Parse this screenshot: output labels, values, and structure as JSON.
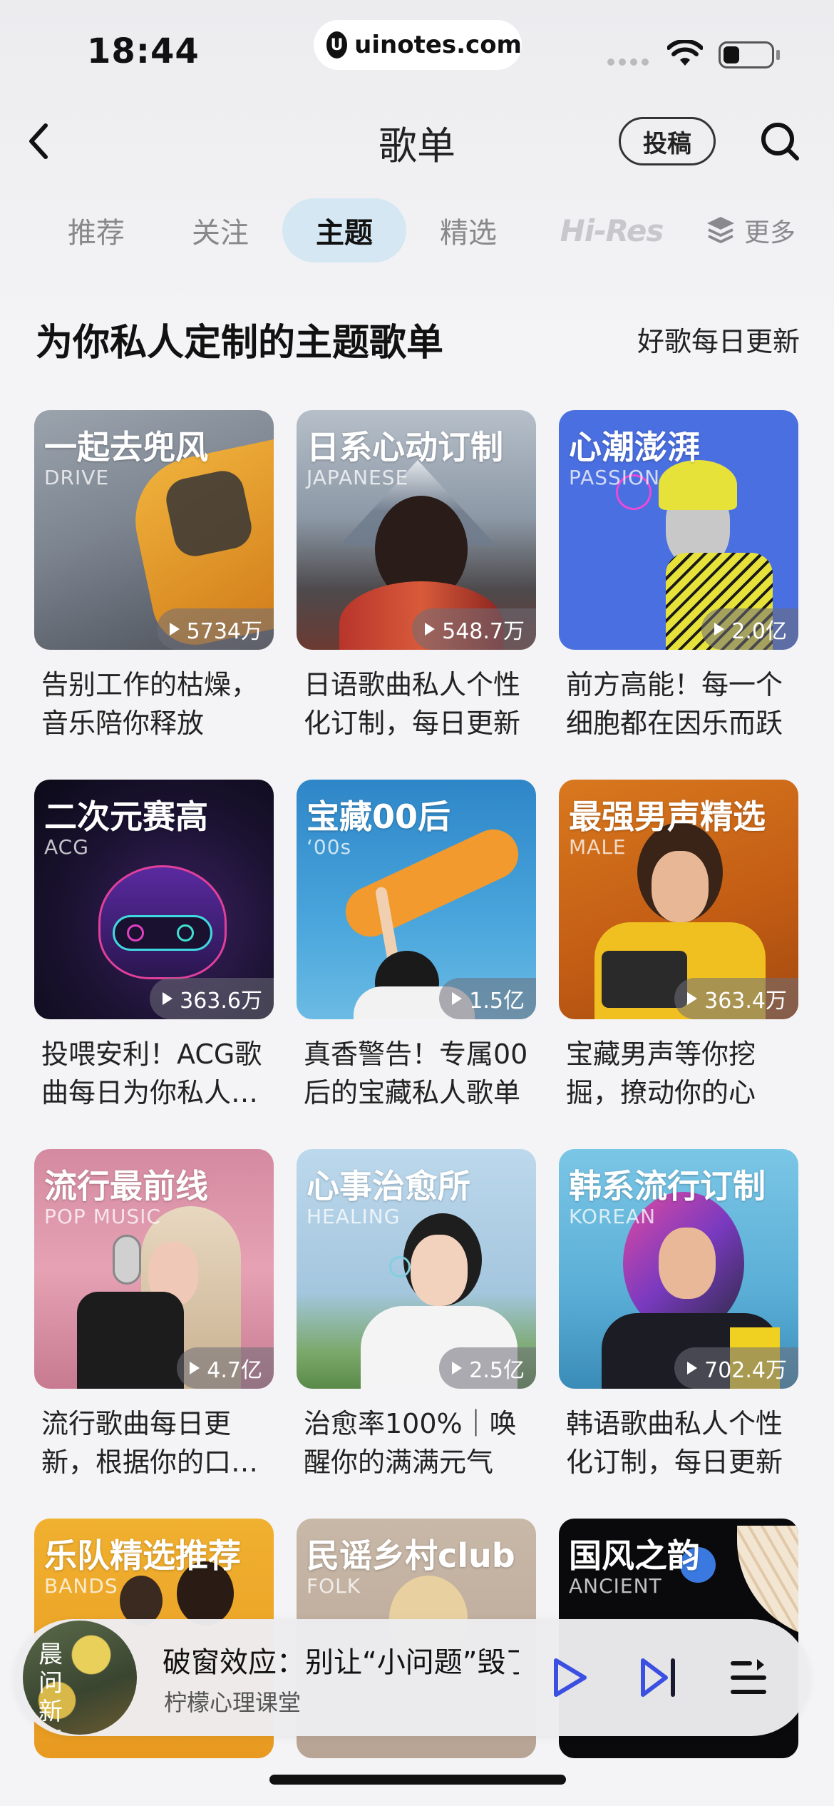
{
  "status_bar": {
    "time": "18:44",
    "url": "uinotes.com"
  },
  "nav": {
    "title": "歌单",
    "submit_label": "投稿"
  },
  "tabs": [
    {
      "label": "推荐",
      "active": false
    },
    {
      "label": "关注",
      "active": false
    },
    {
      "label": "主题",
      "active": true
    },
    {
      "label": "精选",
      "active": false
    },
    {
      "label": "Hi-Res",
      "active": false
    }
  ],
  "tab_more_label": "更多",
  "section": {
    "title": "为你私人定制的主题歌单",
    "subtitle": "好歌每日更新"
  },
  "cards": [
    {
      "title": "一起去兜风",
      "en": "DRIVE",
      "plays": "5734万",
      "desc": "告别工作的枯燥，音乐陪你释放"
    },
    {
      "title": "日系心动订制",
      "en": "JAPANESE",
      "plays": "548.7万",
      "desc": "日语歌曲私人个性化订制，每日更新"
    },
    {
      "title": "心潮澎湃",
      "en": "PASSION",
      "plays": "2.0亿",
      "desc": "前方高能！每一个细胞都在因乐而跃"
    },
    {
      "title": "二次元赛高",
      "en": "ACG",
      "plays": "363.6万",
      "desc": "投喂安利！ACG歌曲每日为你私人定制"
    },
    {
      "title": "宝藏00后",
      "en": "‘00s",
      "plays": "1.5亿",
      "desc": "真香警告！专属00后的宝藏私人歌单"
    },
    {
      "title": "最强男声精选",
      "en": "MALE",
      "plays": "363.4万",
      "desc": "宝藏男声等你挖掘，撩动你的心"
    },
    {
      "title": "流行最前线",
      "en": "POP MUSIC",
      "plays": "4.7亿",
      "desc": "流行歌曲每日更新，根据你的口味推荐"
    },
    {
      "title": "心事治愈所",
      "en": "HEALING",
      "plays": "2.5亿",
      "desc": "治愈率100%｜唤醒你的满满元气"
    },
    {
      "title": "韩系流行订制",
      "en": "KOREAN",
      "plays": "702.4万",
      "desc": "韩语歌曲私人个性化订制，每日更新"
    },
    {
      "title": "乐队精选推荐",
      "en": "BANDS",
      "plays": "",
      "desc": ""
    },
    {
      "title": "民谣乡村club",
      "en": "FOLK",
      "plays": "",
      "desc": ""
    },
    {
      "title": "国风之韵",
      "en": "ANCIENT",
      "plays": "",
      "desc": ""
    }
  ],
  "player": {
    "title": "破窗效应：别让“小问题”毁了你",
    "artist": "柠檬心理课堂",
    "art_text": "晨 问 新 知"
  },
  "colors": {
    "tab_active_bg": "#d4e7f2",
    "play_icon": "#3b4fe0"
  },
  "icons": [
    "back-icon",
    "search-icon",
    "layers-icon",
    "play-icon",
    "next-icon",
    "playlist-icon",
    "wifi-icon",
    "battery-icon"
  ]
}
